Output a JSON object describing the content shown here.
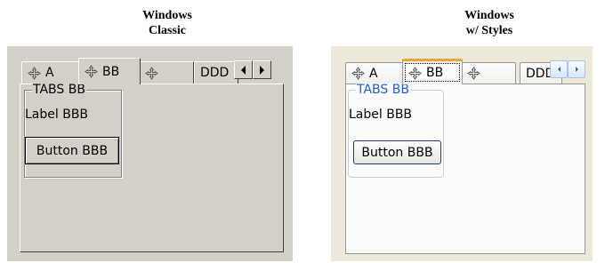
{
  "classic": {
    "heading_line1": "Windows",
    "heading_line2": "Classic",
    "tabs": [
      {
        "label": "A",
        "icon": "move-cross-icon"
      },
      {
        "label": "BB",
        "icon": "move-cross-icon"
      },
      {
        "label": "",
        "icon": "move-cross-icon"
      },
      {
        "label": "DDD",
        "icon": ""
      }
    ],
    "selected_tab": "BB",
    "group_title": "TABS BB",
    "label_text": "Label BBB",
    "button_text": "Button BBB",
    "colors": {
      "face": "#d4d0c8"
    }
  },
  "styled": {
    "heading_line1": "Windows",
    "heading_line2": "w/ Styles",
    "tabs": [
      {
        "label": "A",
        "icon": "move-cross-icon"
      },
      {
        "label": "BB",
        "icon": "move-cross-icon"
      },
      {
        "label": "",
        "icon": "move-cross-icon"
      },
      {
        "label": "DDD",
        "icon": ""
      }
    ],
    "selected_tab": "BB",
    "group_title": "TABS BB",
    "label_text": "Label BBB",
    "button_text": "Button BBB",
    "colors": {
      "face": "#ece9d8",
      "page": "#fcfcfe",
      "accent": "#f2a53b",
      "legend": "#1f5dbf"
    }
  },
  "scroll_arrows": {
    "left_icon": "scroll-left-icon",
    "right_icon": "scroll-right-icon"
  }
}
